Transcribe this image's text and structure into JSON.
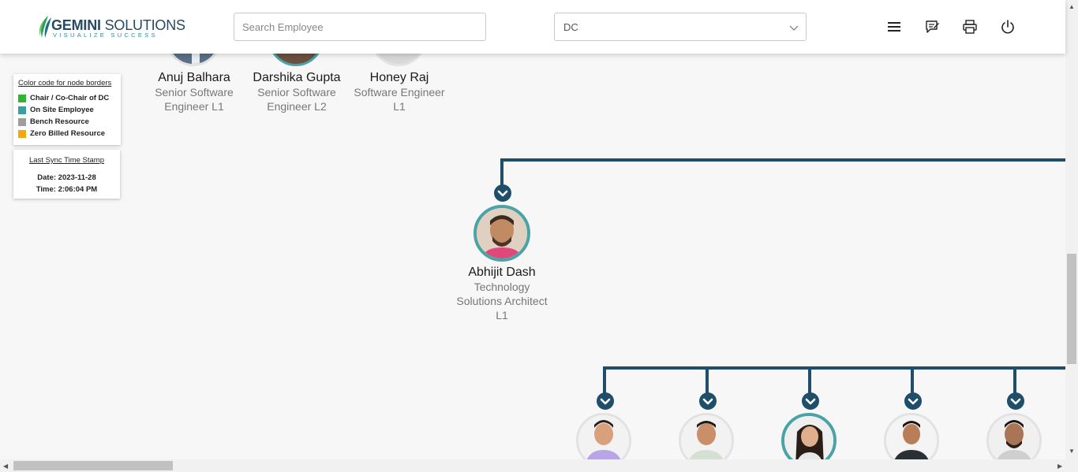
{
  "header": {
    "logo_name_bold": "GEMINI",
    "logo_name_rest": " SOLUTIONS",
    "logo_tagline": "VISUALIZE SUCCESS",
    "search_placeholder": "Search Employee",
    "department_selected": "DC",
    "icons": [
      "menu-icon",
      "feedback-icon",
      "print-icon",
      "power-icon"
    ]
  },
  "legend": {
    "title": "Color code for node borders",
    "items": [
      {
        "label": "Chair / Co-Chair of DC",
        "color": "#2fb52f"
      },
      {
        "label": "On Site Employee",
        "color": "#3a9fa0"
      },
      {
        "label": "Bench Resource",
        "color": "#9e9e9e"
      },
      {
        "label": "Zero Billed Resource",
        "color": "#f2a80e"
      }
    ]
  },
  "sync": {
    "title": "Last Sync Time Stamp",
    "date": "Date: 2023-11-28",
    "time": "Time: 2:06:04 PM"
  },
  "colors": {
    "connector": "#1f4e6b",
    "onsite_border": "#4aa3a6",
    "default_border": "#e2e2e2"
  },
  "top_row": [
    {
      "name": "Anuj Balhara",
      "role": "Senior Software Engineer L1"
    },
    {
      "name": "Darshika Gupta",
      "role": "Senior Software Engineer L2"
    },
    {
      "name": "Honey Raj",
      "role": "Software Engineer L1"
    }
  ],
  "focus": {
    "name": "Abhijit Dash",
    "role": "Technology Solutions Architect L1"
  }
}
